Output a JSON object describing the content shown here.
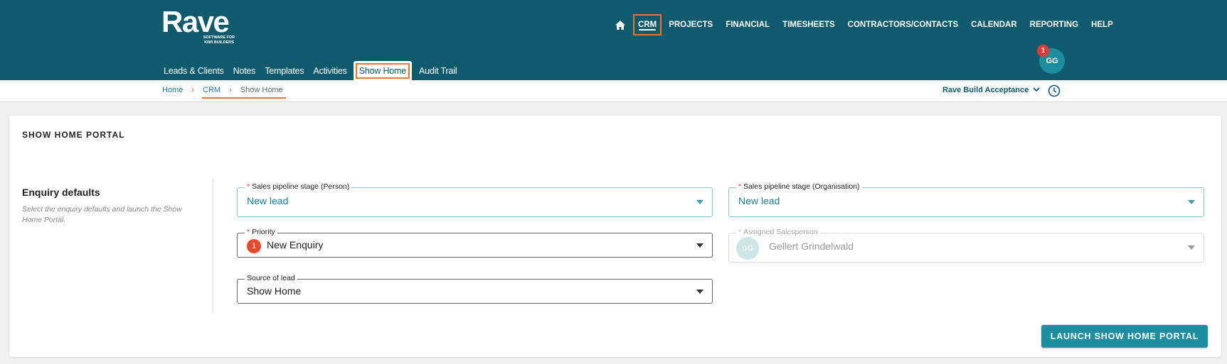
{
  "brand": {
    "name": "Rave",
    "tagline_1": "SOFTWARE FOR",
    "tagline_2": "KIWI BUILDERS"
  },
  "topnav": {
    "items": [
      {
        "label": "CRM"
      },
      {
        "label": "PROJECTS"
      },
      {
        "label": "FINANCIAL"
      },
      {
        "label": "TIMESHEETS"
      },
      {
        "label": "CONTRACTORS/CONTACTS"
      },
      {
        "label": "CALENDAR"
      },
      {
        "label": "REPORTING"
      },
      {
        "label": "HELP"
      }
    ],
    "active": "CRM"
  },
  "user": {
    "initials": "GG",
    "notifications": "1"
  },
  "subnav": {
    "items": [
      {
        "label": "Leads & Clients"
      },
      {
        "label": "Notes"
      },
      {
        "label": "Templates"
      },
      {
        "label": "Activities"
      },
      {
        "label": "Show Home"
      },
      {
        "label": "Audit Trail"
      }
    ],
    "active": "Show Home"
  },
  "breadcrumb": {
    "home": "Home",
    "crm": "CRM",
    "current": "Show Home",
    "separator": "›"
  },
  "org": {
    "name": "Rave Build Acceptance"
  },
  "card": {
    "title": "SHOW HOME PORTAL",
    "section_title": "Enquiry defaults",
    "section_desc": "Select the enquiry defaults and launch the Show Home Portal.",
    "fields": {
      "stage_person": {
        "label": "Sales pipeline stage (Person)",
        "value": "New lead"
      },
      "stage_org": {
        "label": "Sales pipeline stage (Organisation)",
        "value": "New lead"
      },
      "priority": {
        "label": "Priority",
        "value": "New Enquiry",
        "badge": "1"
      },
      "salesperson": {
        "label": "Assigned Salesperson",
        "value": "Gellert Grindelwald",
        "initials": "GG"
      },
      "source": {
        "label": "Source of lead",
        "value": "Show Home"
      }
    },
    "required_marker": "*",
    "launch_button": "LAUNCH SHOW HOME PORTAL"
  },
  "colors": {
    "header": "#0f5a6c",
    "accent": "#1d8ea0",
    "highlight": "#f47421",
    "badge": "#e53935"
  }
}
